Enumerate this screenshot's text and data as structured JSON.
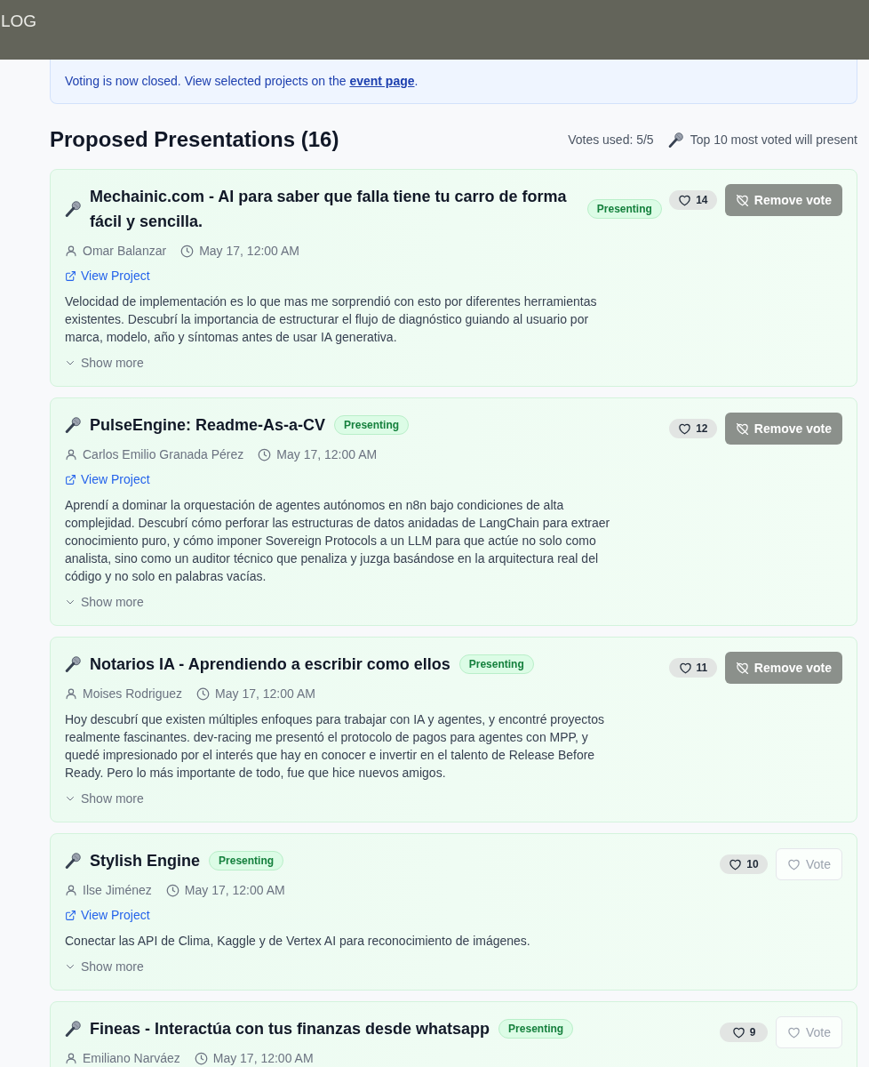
{
  "header": {
    "title": "LOG"
  },
  "notice": {
    "text_before": "Voting is now closed. View selected projects on the ",
    "link": "event page",
    "text_after": "."
  },
  "section": {
    "title": "Proposed Presentations (16)",
    "votes_used": "Votes used: 5/5",
    "rule": "Top 10 most voted will present"
  },
  "presentations": [
    {
      "title": "Mechainic.com - AI para saber que falla tiene tu carro de forma fácil y sencilla.",
      "badge": "Presenting",
      "author": "Omar Balanzar",
      "date": "May 17, 12:00 AM",
      "link": "View Project",
      "description": "Velocidad de implementación es lo que mas me sorprendió con esto por diferentes herramientas existentes. Descubrí la importancia de estructurar el flujo de diagnóstico guiando al usuario por marca, modelo, año y síntomas antes de usar IA generativa.",
      "show_more": "Show more",
      "votes": "14",
      "voted": true,
      "vote_button": "Remove vote"
    },
    {
      "title": "PulseEngine: Readme-As-a-CV",
      "badge": "Presenting",
      "author": "Carlos Emilio Granada Pérez",
      "date": "May 17, 12:00 AM",
      "link": "View Project",
      "description": "Aprendí a dominar la orquestación de agentes autónomos en n8n bajo condiciones de alta complejidad. Descubrí cómo perforar las estructuras de datos anidadas de LangChain para extraer conocimiento puro, y cómo imponer Sovereign Protocols a un LLM para que actúe no solo como analista, sino como un auditor técnico que penaliza y juzga basándose en la arquitectura real del código y no solo en palabras vacías.",
      "show_more": "Show more",
      "votes": "12",
      "voted": true,
      "vote_button": "Remove vote"
    },
    {
      "title": "Notarios IA - Aprendiendo a escribir como ellos",
      "badge": "Presenting",
      "author": "Moises Rodriguez",
      "date": "May 17, 12:00 AM",
      "description": "Hoy descubrí que existen múltiples enfoques para trabajar con IA y agentes, y encontré proyectos realmente fascinantes. dev-racing me presentó el protocolo de pagos para agentes con MPP, y quedé impresionado por el interés que hay en conocer e invertir en el talento de Release Before Ready. Pero lo más importante de todo, fue que hice nuevos amigos.",
      "show_more": "Show more",
      "votes": "11",
      "voted": true,
      "vote_button": "Remove vote"
    },
    {
      "title": "Stylish Engine",
      "badge": "Presenting",
      "author": "Ilse Jiménez",
      "date": "May 17, 12:00 AM",
      "link": "View Project",
      "description": "Conectar las API de Clima, Kaggle y de Vertex AI para reconocimiento de imágenes.",
      "show_more": "Show more",
      "votes": "10",
      "voted": false,
      "vote_button": "Vote"
    },
    {
      "title": "Fineas - Interactúa con tus finanzas desde whatsapp",
      "badge": "Presenting",
      "author": "Emiliano Narváez",
      "date": "May 17, 12:00 AM",
      "votes": "9",
      "voted": false,
      "vote_button": "Vote"
    }
  ]
}
